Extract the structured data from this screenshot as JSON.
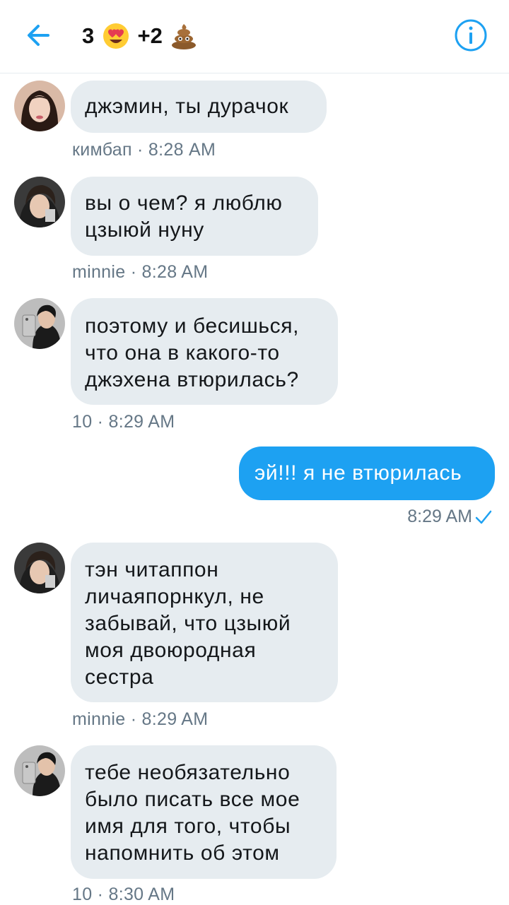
{
  "header": {
    "title_prefix": "3 ",
    "title_middle": " +2 ",
    "heart_icon": "heart-eyes-emoji",
    "poop_icon": "poop-emoji",
    "back_icon": "arrow-left-icon",
    "info_icon": "info-icon",
    "accent_color": "#1da1f2"
  },
  "messages": [
    {
      "text": "джэмин, ты дурачок",
      "meta": "кимбап · 8:28 AM",
      "avatar": "avatar-kimbap"
    },
    {
      "text": "вы о чем? я люблю\nцзыюй нуну",
      "meta": "minnie · 8:28 AM",
      "avatar": "avatar-minnie"
    },
    {
      "text": "поэтому и бесишься,\nчто она в какого-то\nджэхена втюрилась?",
      "meta": "10 · 8:29 AM",
      "avatar": "avatar-10"
    },
    {
      "text": "тэн читаппон\nличаяпорнкул, не\nзабывай, что цзыюй\nмоя двоюродная\nсестра",
      "meta": "minnie · 8:29 AM",
      "avatar": "avatar-minnie"
    },
    {
      "text": "тебе необязательно\nбыло писать все мое\nимя для того, чтобы\nнапомнить об этом",
      "meta": "10 · 8:30 AM",
      "avatar": "avatar-10"
    }
  ],
  "outgoing": {
    "text": "эй!!! я не втюрилась",
    "meta": "8:29 AM",
    "status_icon": "checkmark-icon"
  }
}
